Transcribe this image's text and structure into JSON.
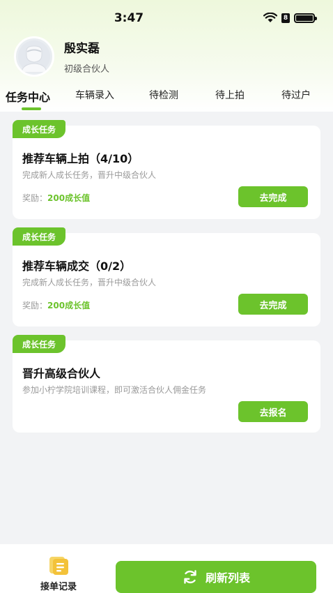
{
  "status_bar": {
    "time": "3:47"
  },
  "profile": {
    "name": "殷实磊",
    "role": "初级合伙人"
  },
  "tabs": [
    {
      "label": "任务中心",
      "active": true
    },
    {
      "label": "车辆录入",
      "active": false
    },
    {
      "label": "待检测",
      "active": false
    },
    {
      "label": "待上拍",
      "active": false
    },
    {
      "label": "待过户",
      "active": false
    }
  ],
  "tasks": [
    {
      "tag": "成长任务",
      "title": "推荐车辆上拍（4/10）",
      "desc": "完成新人成长任务，晋升中级合伙人",
      "reward_label": "奖励：",
      "reward_value": "200成长值",
      "button": "去完成"
    },
    {
      "tag": "成长任务",
      "title": "推荐车辆成交（0/2）",
      "desc": "完成新人成长任务，晋升中级合伙人",
      "reward_label": "奖励：",
      "reward_value": "200成长值",
      "button": "去完成"
    },
    {
      "tag": "成长任务",
      "title": "晋升高级合伙人",
      "desc": "参加小柠学院培训课程，即可激活合伙人佣金任务",
      "button": "去报名"
    }
  ],
  "bottom": {
    "records_label": "接单记录",
    "refresh_label": "刷新列表"
  },
  "colors": {
    "accent": "#6cc32c",
    "background": "#f2f3f5"
  },
  "icons": [
    "wifi-icon",
    "battery-icon",
    "avatar-icon",
    "records-icon",
    "refresh-icon"
  ]
}
